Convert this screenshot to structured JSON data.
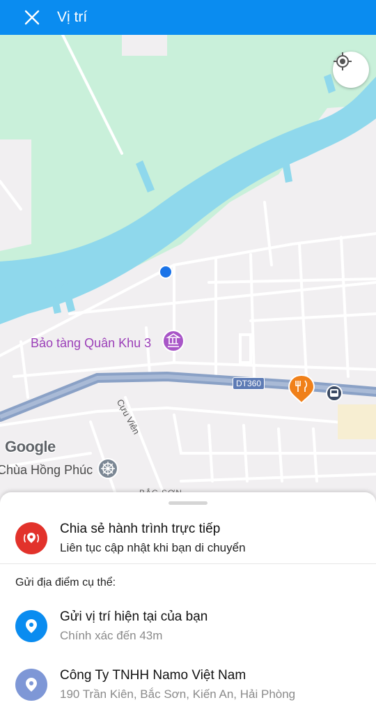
{
  "header": {
    "title": "Vị trí",
    "close_icon": "close-icon"
  },
  "map": {
    "museum_label": "Bảo tàng Quân Khu 3",
    "pagoda_label": "Chùa Hồng Phúc",
    "street_label": "Cựu Viên",
    "road_badge": "DT360",
    "bottom_label": "BẮC SƠN",
    "logo": "Google",
    "colors": {
      "water": "#8fd8ec",
      "park": "#c9f0da",
      "land": "#f1eff1",
      "road": "#ffffff",
      "highway": "#8aa1c6",
      "current_location": "#1a73e8"
    }
  },
  "sheet": {
    "live_share": {
      "title": "Chia sẻ hành trình trực tiếp",
      "subtitle": "Liên tục cập nhật khi bạn di chuyển",
      "icon": "live-location-icon",
      "color": "#e2322b"
    },
    "section_label": "Gửi địa điểm cụ thể:",
    "current_location": {
      "title": "Gửi vị trí hiện tại của bạn",
      "subtitle": "Chính xác đến 43m",
      "icon": "location-pin-icon",
      "color": "#0a8cf0"
    },
    "place": {
      "title": "Công Ty TNHH Namo Việt Nam",
      "subtitle": "190 Trần Kiên, Bắc Sơn, Kiến An, Hải Phòng",
      "icon": "location-pin-icon",
      "color": "#7e97d6"
    }
  }
}
